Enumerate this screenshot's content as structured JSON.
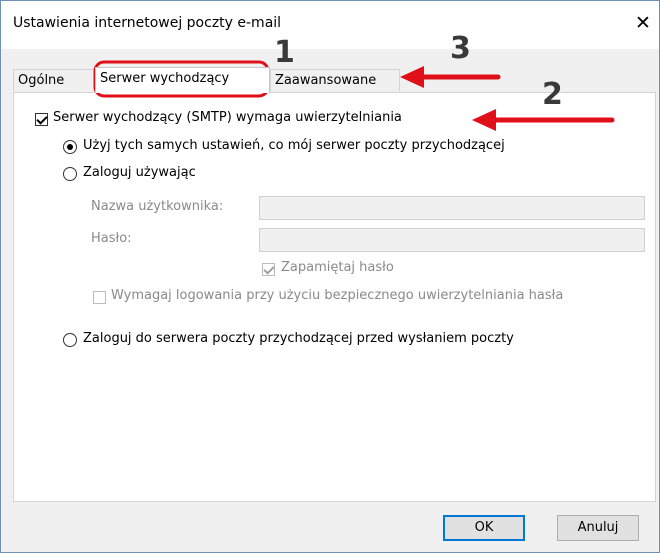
{
  "window": {
    "title": "Ustawienia internetowej poczty e-mail",
    "close_glyph": "✕"
  },
  "tabs": [
    {
      "label": "Ogólne"
    },
    {
      "label": "Serwer wychodzący",
      "active": true
    },
    {
      "label": "Zaawansowane"
    }
  ],
  "smtp_auth": {
    "label": "Serwer wychodzący (SMTP) wymaga uwierzytelniania",
    "checked": true
  },
  "options": {
    "same_settings": {
      "label": "Użyj tych samych ustawień, co mój serwer poczty przychodzącej",
      "selected": true
    },
    "login_using": {
      "label": "Zaloguj używając",
      "selected": false
    },
    "username_label": "Nazwa użytkownika:",
    "username_value": "",
    "password_label": "Hasło:",
    "password_value": "",
    "remember_password": {
      "label": "Zapamiętaj hasło",
      "checked": true,
      "disabled": true
    },
    "require_spa": {
      "label": "Wymagaj logowania przy użyciu bezpiecznego uwierzytelniania hasła",
      "checked": false,
      "disabled": true
    },
    "login_before_send": {
      "label": "Zaloguj do serwera poczty przychodzącej przed wysłaniem poczty",
      "selected": false
    }
  },
  "buttons": {
    "ok": "OK",
    "cancel": "Anuluj"
  },
  "annotations": {
    "n1": "1",
    "n2": "2",
    "n3": "3",
    "highlight_color": "#e0101a",
    "number_color": "#3a3a3a"
  }
}
